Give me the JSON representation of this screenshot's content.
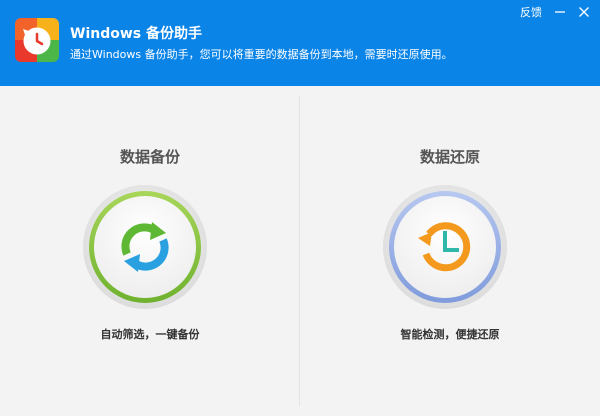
{
  "header": {
    "app_icon": "backup-clock-icon",
    "title": "Windows 备份助手",
    "subtitle": "通过Windows 备份助手，您可以将重要的数据备份到本地，需要时还原使用。",
    "feedback_label": "反馈",
    "bg_color": "#0b84e8"
  },
  "left_panel": {
    "title": "数据备份",
    "description": "自动筛选，一键备份",
    "icon": "sync-arrows-icon",
    "ring_color": "#8bc34a"
  },
  "right_panel": {
    "title": "数据还原",
    "description": "智能检测，便捷还原",
    "icon": "restore-clock-icon",
    "ring_color": "#8ea9e6"
  }
}
